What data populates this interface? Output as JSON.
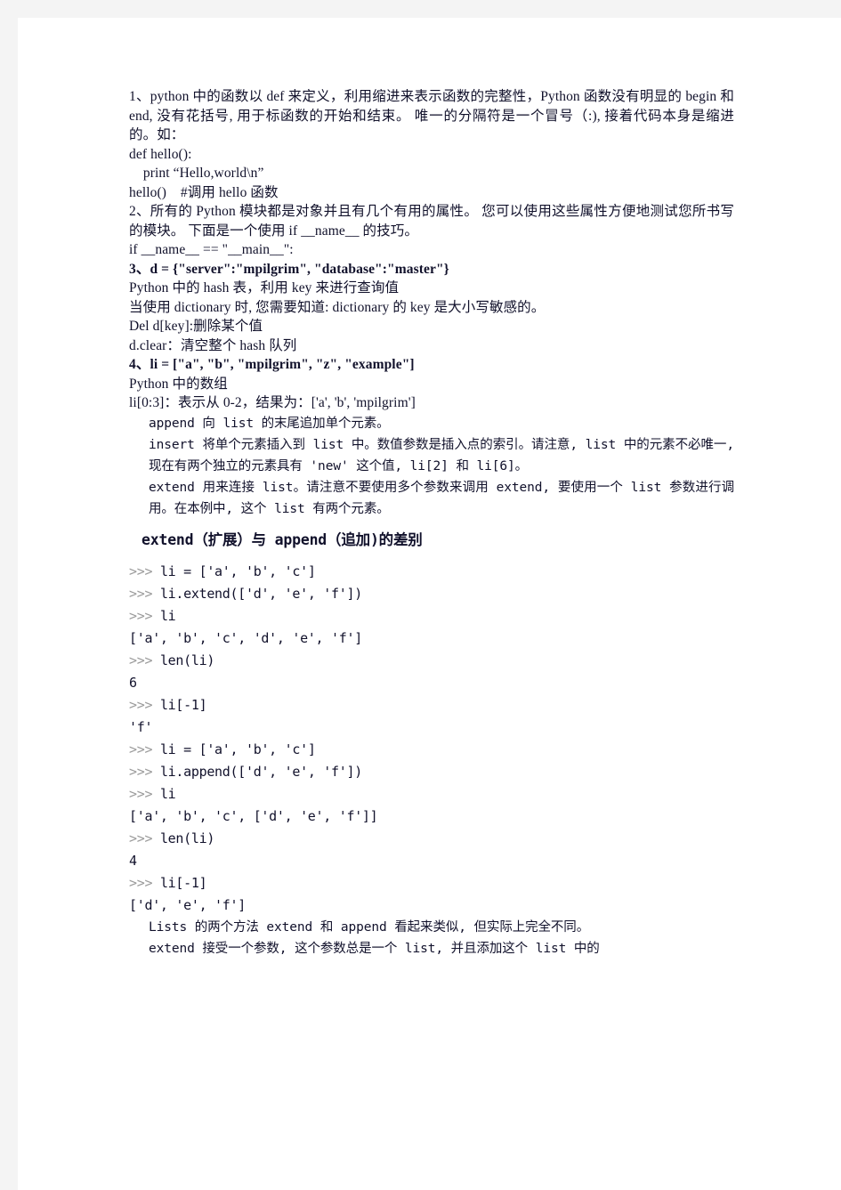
{
  "document": {
    "colors": {
      "page_background": "#ffffff",
      "scan_gutter": "#f4f4f4",
      "text": "#11112b",
      "prompt_grey": "#9b9b9b"
    },
    "paragraphs": [
      {
        "id": "item-1",
        "style": "serif",
        "text": "1、python 中的函数以 def 来定义，利用缩进来表示函数的完整性，Python 函数没有明显的 begin 和 end, 没有花括号, 用于标函数的开始和结束。 唯一的分隔符是一个冒号（:), 接着代码本身是缩进的。如："
      },
      {
        "id": "def-hello",
        "style": "serif",
        "text": "def hello():"
      },
      {
        "id": "print-hello",
        "style": "serif",
        "text": "    print “Hello,world\\n”"
      },
      {
        "id": "call-hello",
        "style": "serif",
        "text": "hello()    #调用 hello 函数"
      },
      {
        "id": "item-2",
        "style": "serif",
        "text": "2、所有的 Python 模块都是对象并且有几个有用的属性。 您可以使用这些属性方便地测试您所书写的模块。 下面是一个使用 if __name__ 的技巧。"
      },
      {
        "id": "if-name-main",
        "style": "serif",
        "text": "if __name__ == \"__main__\":"
      },
      {
        "id": "item-3",
        "style": "serif-bold",
        "text": "3、d = {\"server\":\"mpilgrim\", \"database\":\"master\"}"
      },
      {
        "id": "hash-table",
        "style": "serif",
        "text": "Python 中的 hash 表，利用 key 来进行查询值"
      },
      {
        "id": "dict-case",
        "style": "serif",
        "text": "当使用 dictionary 时, 您需要知道: dictionary 的 key 是大小写敏感的。"
      },
      {
        "id": "del-dkey",
        "style": "serif",
        "text": "Del  d[key]:删除某个值"
      },
      {
        "id": "d-clear",
        "style": "serif",
        "text": "d.clear：清空整个 hash 队列"
      },
      {
        "id": "item-4",
        "style": "serif-bold",
        "text": "4、li = [\"a\", \"b\", \"mpilgrim\", \"z\", \"example\"]"
      },
      {
        "id": "python-array",
        "style": "serif",
        "text": "Python 中的数组"
      },
      {
        "id": "li-slice",
        "style": "serif",
        "text": "li[0:3]：表示从 0-2，结果为：['a', 'b', 'mpilgrim']"
      }
    ],
    "method_notes": [
      {
        "id": "note-append",
        "text": "append 向 list 的末尾追加单个元素。"
      },
      {
        "id": "note-insert",
        "text": "insert 将单个元素插入到 list 中。数值参数是插入点的索引。请注意, list 中的元素不必唯一, 现在有两个独立的元素具有 'new' 这个值, li[2] 和 li[6]。"
      },
      {
        "id": "note-extend",
        "text": "extend 用来连接 list。请注意不要使用多个参数来调用 extend, 要使用一个 list 参数进行调用。在本例中, 这个 list 有两个元素。"
      }
    ],
    "section_heading": "extend（扩展）与 append（追加)的差别",
    "code_session": [
      {
        "prompt": ">>> ",
        "code": "li = ['a', 'b', 'c']"
      },
      {
        "prompt": ">>> ",
        "code": "li.extend(['d', 'e', 'f'])"
      },
      {
        "prompt": ">>> ",
        "code": "li"
      },
      {
        "prompt": "",
        "code": "['a', 'b', 'c', 'd', 'e', 'f']"
      },
      {
        "prompt": ">>> ",
        "code": "len(li)"
      },
      {
        "prompt": "",
        "code": "6"
      },
      {
        "prompt": ">>> ",
        "code": "li[-1]"
      },
      {
        "prompt": "",
        "code": "'f'"
      },
      {
        "prompt": ">>> ",
        "code": "li = ['a', 'b', 'c']"
      },
      {
        "prompt": ">>> ",
        "code": "li.append(['d', 'e', 'f'])"
      },
      {
        "prompt": ">>> ",
        "code": "li"
      },
      {
        "prompt": "",
        "code": "['a', 'b', 'c', ['d', 'e', 'f']]"
      },
      {
        "prompt": ">>> ",
        "code": "len(li)"
      },
      {
        "prompt": "",
        "code": "4"
      },
      {
        "prompt": ">>> ",
        "code": "li[-1]"
      },
      {
        "prompt": "",
        "code": "['d', 'e', 'f']"
      }
    ],
    "closing_notes": [
      {
        "id": "closing-1",
        "text": "Lists 的两个方法 extend 和 append 看起来类似, 但实际上完全不同。"
      },
      {
        "id": "closing-2",
        "text": "extend 接受一个参数, 这个参数总是一个 list, 并且添加这个 list 中的"
      }
    ]
  }
}
